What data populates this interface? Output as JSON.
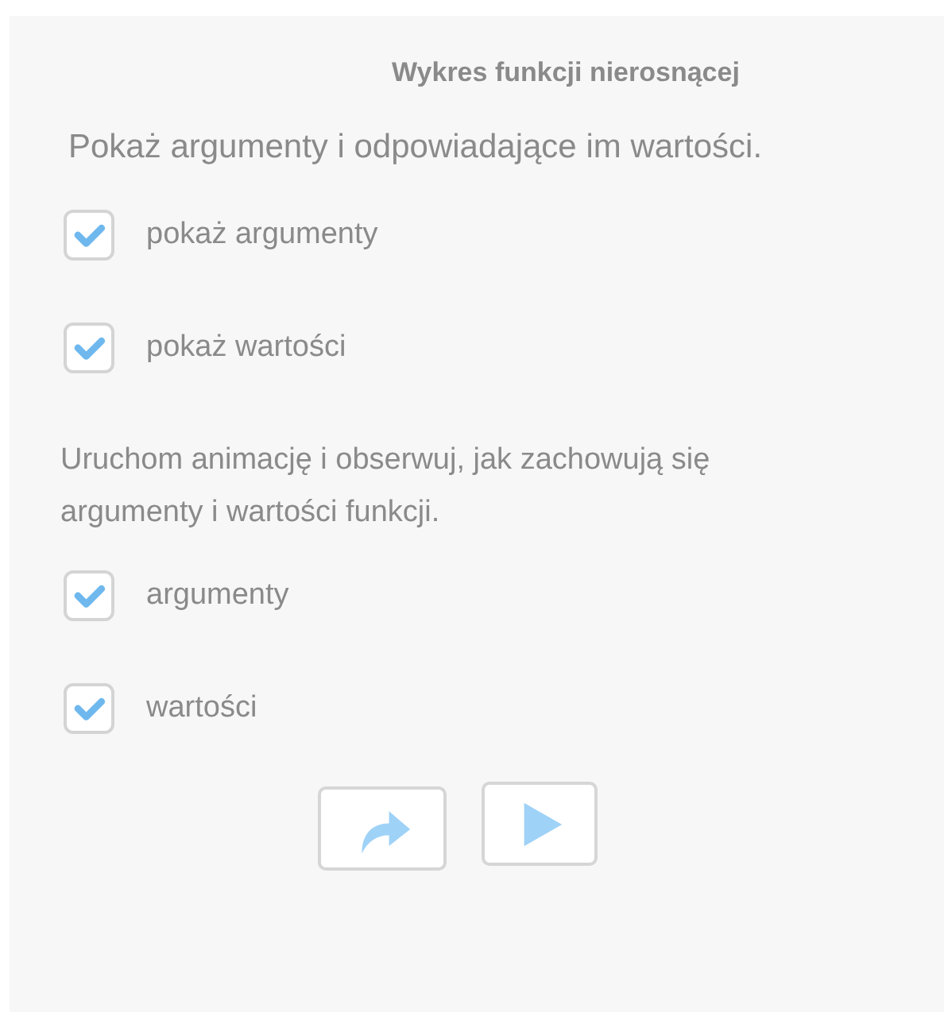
{
  "panel": {
    "title": "Wykres funkcji nierosnącej",
    "sections": [
      {
        "text": "Pokaż argumenty i odpowiadające im wartości.",
        "kind": "lead",
        "checkboxes": [
          {
            "label": "pokaż argumenty",
            "checked": true
          },
          {
            "label": "pokaż wartości",
            "checked": true
          }
        ]
      },
      {
        "text": "Uruchom animację i obserwuj, jak zachowują się argumenty i wartości funkcji.",
        "kind": "body",
        "checkboxes": [
          {
            "label": "argumenty",
            "checked": true
          },
          {
            "label": "wartości",
            "checked": true
          }
        ]
      }
    ],
    "buttons": [
      {
        "kind": "redo"
      },
      {
        "kind": "play"
      }
    ]
  }
}
